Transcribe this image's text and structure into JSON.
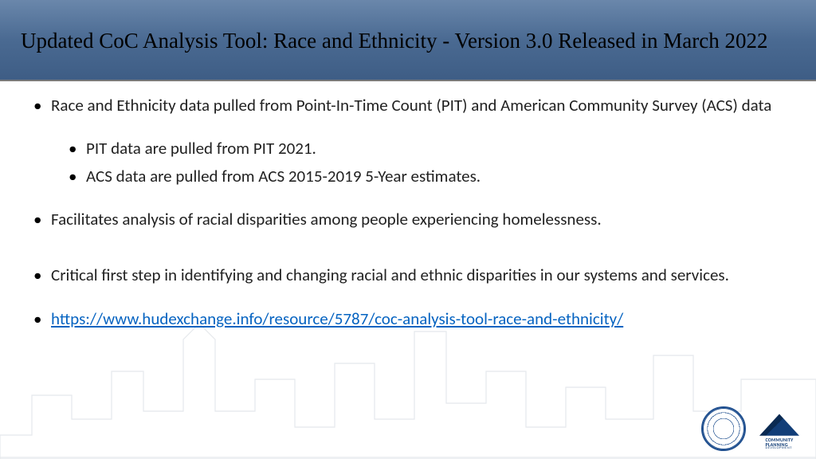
{
  "title": "Updated CoC Analysis Tool: Race and Ethnicity  - Version 3.0 Released in March 2022",
  "bullets": {
    "b1": "Race and Ethnicity data pulled from Point-In-Time Count (PIT) and American Community Survey (ACS) data",
    "b2": "PIT data are pulled from PIT 2021.",
    "b3": "ACS data are pulled from ACS 2015-2019 5-Year estimates.",
    "b4": "Facilitates analysis of racial disparities among people experiencing homelessness.",
    "b5": "Critical first step in identifying and changing racial and ethnic disparities in our systems and services.",
    "link_text": "https://www.hudexchange.info/resource/5787/coc-analysis-tool-race-and-ethnicity/",
    "link_href": "https://www.hudexchange.info/resource/5787/coc-analysis-tool-race-and-ethnicity/"
  },
  "logos": {
    "hud_alt": "HUD Seal",
    "cpd_line1": "COMMUNITY",
    "cpd_line2": "PLANNING",
    "cpd_line3": "DEVELOPMENT"
  }
}
